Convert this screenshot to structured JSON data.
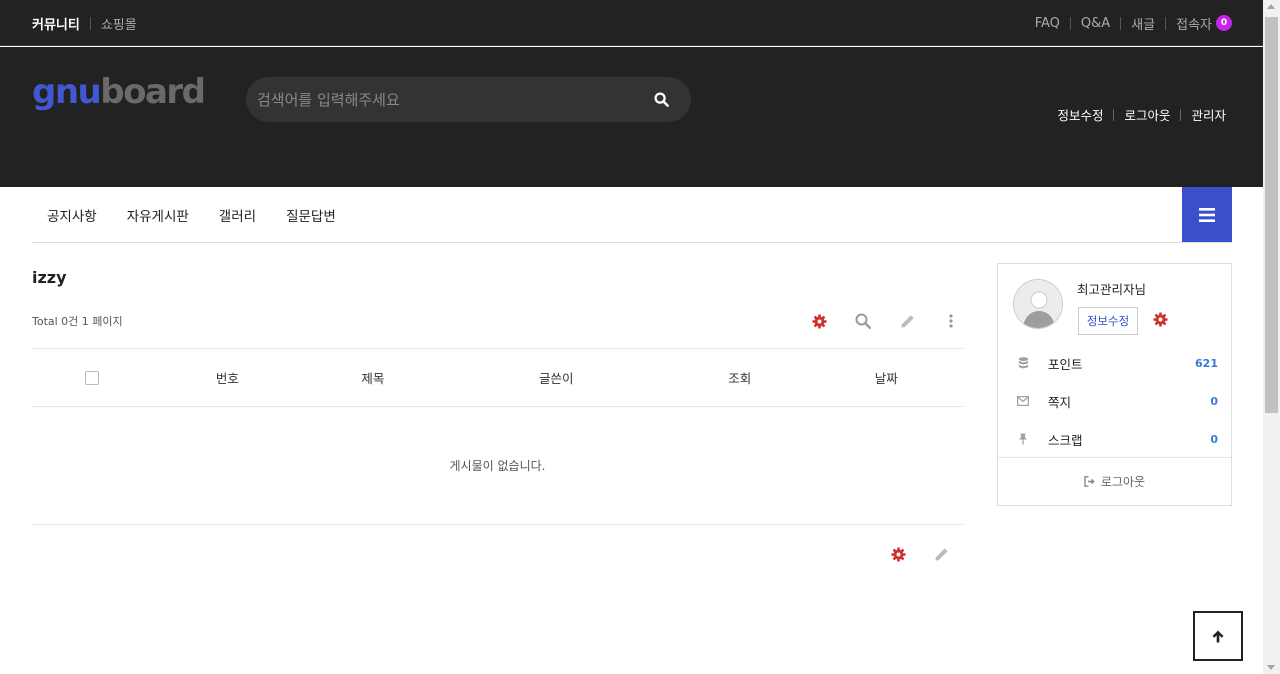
{
  "topbar": {
    "left": [
      "커뮤니티",
      "쇼핑몰"
    ],
    "right": [
      "FAQ",
      "Q&A",
      "새글",
      "접속자"
    ],
    "visitor_count": "0"
  },
  "header": {
    "logo_gnu": "gnu",
    "logo_board": "board",
    "search_placeholder": "검색어를 입력해주세요",
    "user_links": [
      "정보수정",
      "로그아웃",
      "관리자"
    ]
  },
  "nav": {
    "items": [
      "공지사항",
      "자유게시판",
      "갤러리",
      "질문답변"
    ]
  },
  "board": {
    "title": "izzy",
    "count_text": "Total 0건 1 페이지",
    "columns": [
      "번호",
      "제목",
      "글쓴이",
      "조회",
      "날짜"
    ],
    "empty_message": "게시물이 없습니다."
  },
  "profile": {
    "nickname": "최고관리자님",
    "edit_label": "정보수정",
    "stats": [
      {
        "label": "포인트",
        "value": "621"
      },
      {
        "label": "쪽지",
        "value": "0"
      },
      {
        "label": "스크랩",
        "value": "0"
      }
    ],
    "logout_label": "로그아웃"
  },
  "colors": {
    "accent": "#3a4fcc",
    "gear": "#d0302f",
    "badge": "#c425e7",
    "header_bg": "#222222"
  },
  "icons": [
    "search-icon",
    "hamburger-icon",
    "gear-icon",
    "pencil-icon",
    "more-vertical-icon",
    "database-icon",
    "envelope-icon",
    "pin-icon",
    "sign-out-icon",
    "arrow-up-icon"
  ]
}
